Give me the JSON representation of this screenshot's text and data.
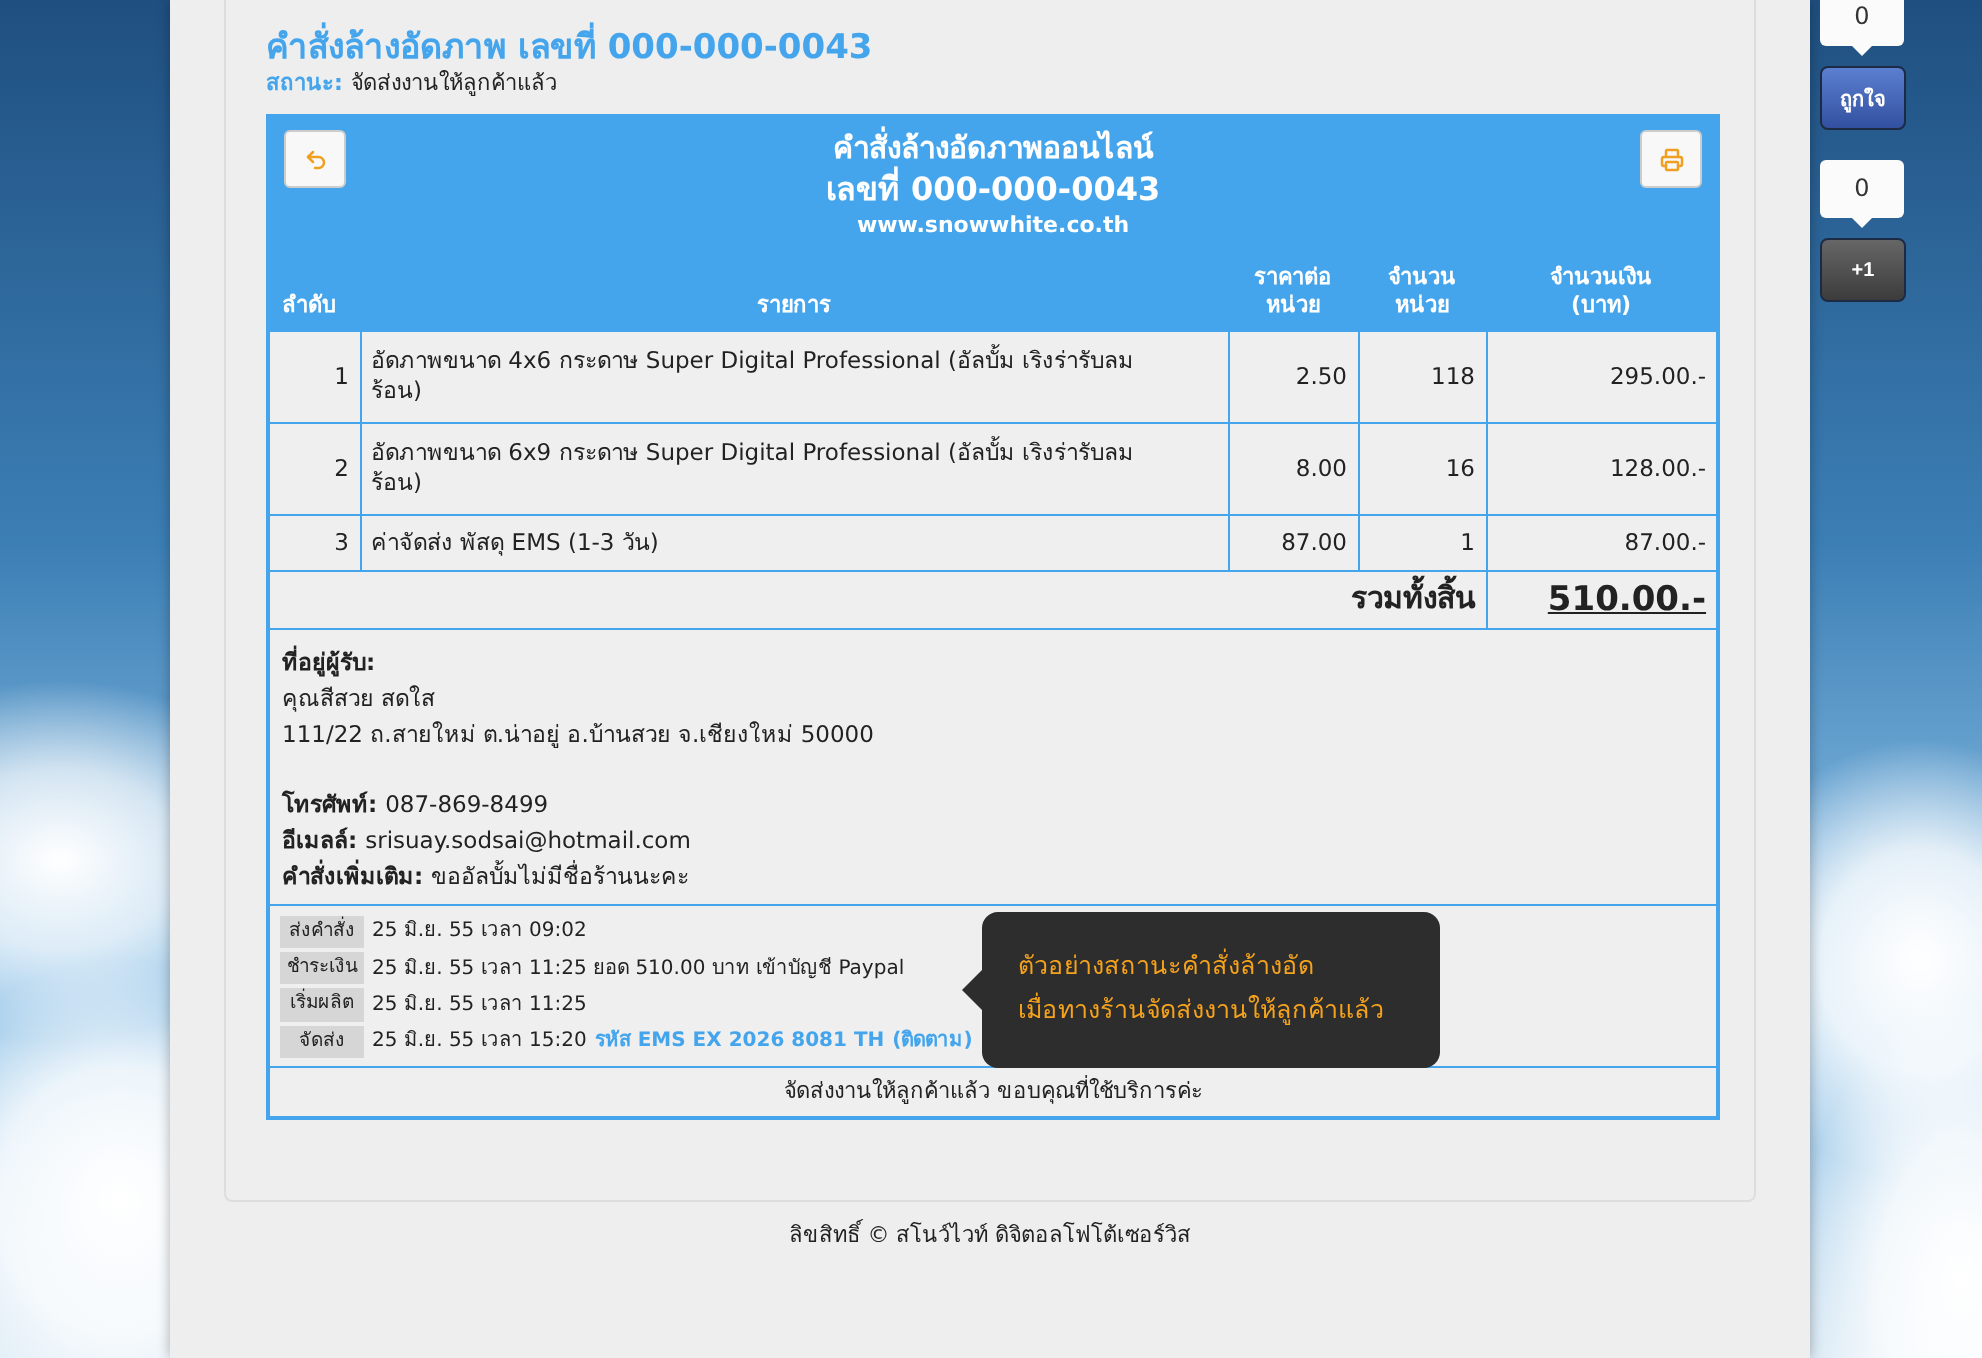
{
  "page": {
    "title": "คำสั่งล้างอัดภาพ เลขที่ 000-000-0043",
    "status_label": "สถานะ:",
    "status": "จัดส่งงานให้ลูกค้าแล้ว"
  },
  "order": {
    "heading": "คำสั่งล้างอัดภาพออนไลน์",
    "number": "เลขที่ 000-000-0043",
    "website": "www.snowwhite.co.th",
    "columns": [
      {
        "lines": [
          "ลำดับ"
        ]
      },
      {
        "lines": [
          "รายการ"
        ]
      },
      {
        "lines": [
          "ราคาต่อ",
          "หน่วย"
        ]
      },
      {
        "lines": [
          "จำนวน",
          "หน่วย"
        ]
      },
      {
        "lines": [
          "จำนวนเงิน",
          "(บาท)"
        ]
      }
    ],
    "rows": [
      {
        "no": "1",
        "item": "อัดภาพขนาด 4x6 กระดาษ Super Digital Professional (อัลบั้ม เริงร่ารับลมร้อน)",
        "unit_price": "2.50",
        "qty": "118",
        "amount": "295.00.-"
      },
      {
        "no": "2",
        "item": "อัดภาพขนาด 6x9 กระดาษ Super Digital Professional (อัลบั้ม เริงร่ารับลมร้อน)",
        "unit_price": "8.00",
        "qty": "16",
        "amount": "128.00.-"
      },
      {
        "no": "3",
        "item": "ค่าจัดส่ง พัสดุ EMS (1-3 วัน)",
        "unit_price": "87.00",
        "qty": "1",
        "amount": "87.00.-"
      }
    ],
    "total_label": "รวมทั้งสิ้น",
    "total": "510.00.-"
  },
  "recipient": {
    "label": "ที่อยู่ผู้รับ:",
    "name": "คุณสีสวย สดใส",
    "address": "111/22 ถ.สายใหม่ ต.น่าอยู่ อ.บ้านสวย จ.เชียงใหม่ 50000",
    "fields": [
      {
        "label": "โทรศัพท์:",
        "value": "087-869-8499"
      },
      {
        "label": "อีเมลล์:",
        "value": "srisuay.sodsai@hotmail.com"
      },
      {
        "label": "คำสั่งเพิ่มเติม:",
        "value": "ขออัลบั้มไม่มีชื่อร้านนะคะ"
      }
    ]
  },
  "timeline": [
    {
      "label": "ส่งคำสั่ง",
      "text": "25 มิ.ย. 55 เวลา 09:02"
    },
    {
      "label": "ชำระเงิน",
      "text": "25 มิ.ย. 55 เวลา 11:25 ยอด 510.00 บาท เข้าบัญชี Paypal"
    },
    {
      "label": "เริ่มผลิต",
      "text": "25 มิ.ย. 55 เวลา 11:25"
    },
    {
      "label": "จัดส่ง",
      "text": "25 มิ.ย. 55 เวลา 15:20",
      "tracking_link": "รหัส EMS EX 2026 8081 TH",
      "track_link": "(ติดตาม)"
    }
  ],
  "tooltip": [
    "ตัวอย่างสถานะคำสั่งล้างอัด",
    "เมื่อทางร้านจัดส่งงานให้ลูกค้าแล้ว"
  ],
  "thanks": "จัดส่งงานให้ลูกค้าแล้ว ขอบคุณที่ใช้บริการค่ะ",
  "copyright": "ลิขสิทธิ์ © สโนว์ไวท์ ดิจิตอลโฟโต้เซอร์วิส",
  "social": [
    {
      "kind": "like",
      "count": "0",
      "label": "ถูกใจ"
    },
    {
      "kind": "plusone",
      "count": "0",
      "label": "+1"
    }
  ]
}
